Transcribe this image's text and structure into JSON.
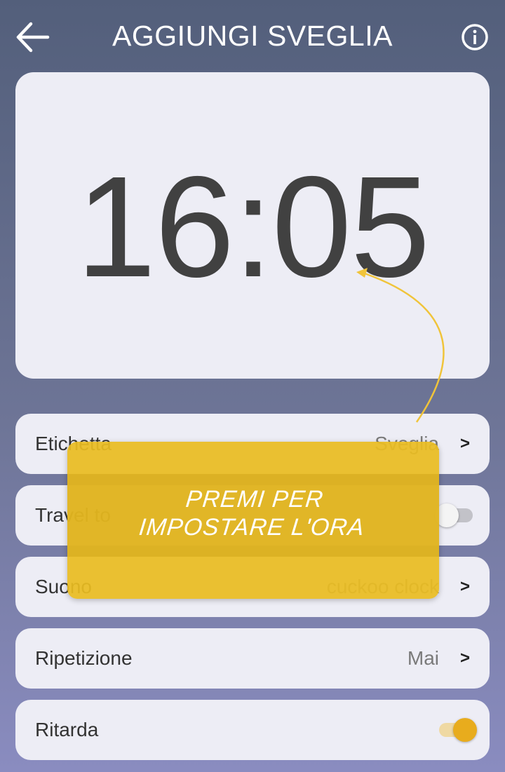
{
  "header": {
    "title": "AGGIUNGI SVEGLIA",
    "back_icon": "arrow-left-icon",
    "info_icon": "info-icon"
  },
  "time": {
    "value": "16:05"
  },
  "rows": [
    {
      "label": "Etichetta",
      "value": "Sveglia",
      "chevron": ">"
    },
    {
      "label": "Travel to",
      "toggle": "off"
    },
    {
      "label": "Suono",
      "value": "cuckoo clock",
      "chevron": ">"
    },
    {
      "label": "Ripetizione",
      "value": "Mai",
      "chevron": ">"
    },
    {
      "label": "Ritarda",
      "toggle": "on"
    }
  ],
  "tooltip": {
    "line1": "PREMI PER",
    "line2": "IMPOSTARE L'ORA"
  },
  "colors": {
    "accent": "#e8ac1d",
    "card": "#ededf5",
    "tooltip": "#eabc21"
  }
}
